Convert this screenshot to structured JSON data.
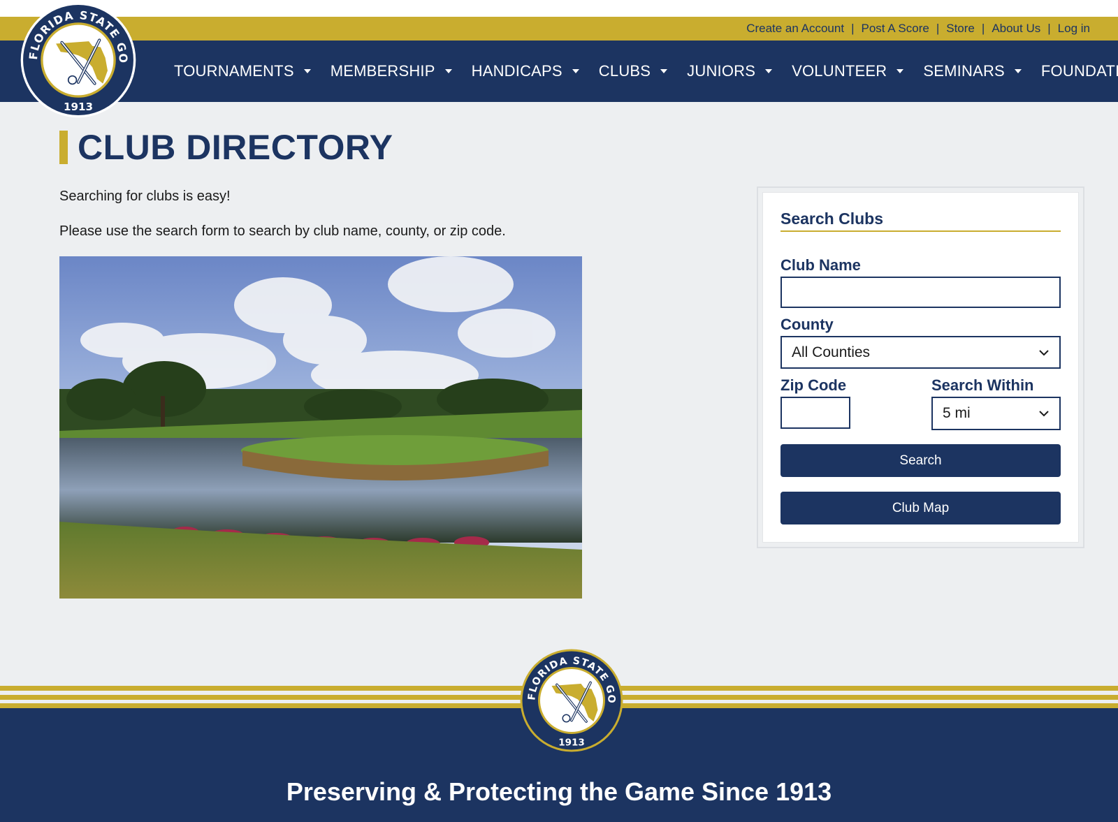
{
  "header": {
    "utility_links": [
      "Create an Account",
      "Post A Score",
      "Store",
      "About Us",
      "Log in"
    ],
    "utility_separator": "|",
    "nav_items": [
      "TOURNAMENTS",
      "MEMBERSHIP",
      "HANDICAPS",
      "CLUBS",
      "JUNIORS",
      "VOLUNTEER",
      "SEMINARS",
      "FOUNDATION"
    ],
    "logo": {
      "ring_text": "FLORIDA STATE GOLF ASSOCIATION",
      "year": "1913"
    }
  },
  "main": {
    "title": "CLUB DIRECTORY",
    "intro_line_1": "Searching for clubs is easy!",
    "intro_line_2": "Please use the search form to search by club name, county, or zip code."
  },
  "search_panel": {
    "title": "Search Clubs",
    "club_name_label": "Club Name",
    "club_name_value": "",
    "county_label": "County",
    "county_value": "All Counties",
    "zip_label": "Zip Code",
    "zip_value": "",
    "within_label": "Search Within",
    "within_value": "5 mi",
    "search_button": "Search",
    "map_button": "Club Map"
  },
  "footer": {
    "tagline": "Preserving & Protecting the Game Since 1913",
    "logo_year": "1913"
  },
  "colors": {
    "navy": "#1c3461",
    "gold": "#c9ad2f",
    "page_bg": "#edeff1"
  }
}
